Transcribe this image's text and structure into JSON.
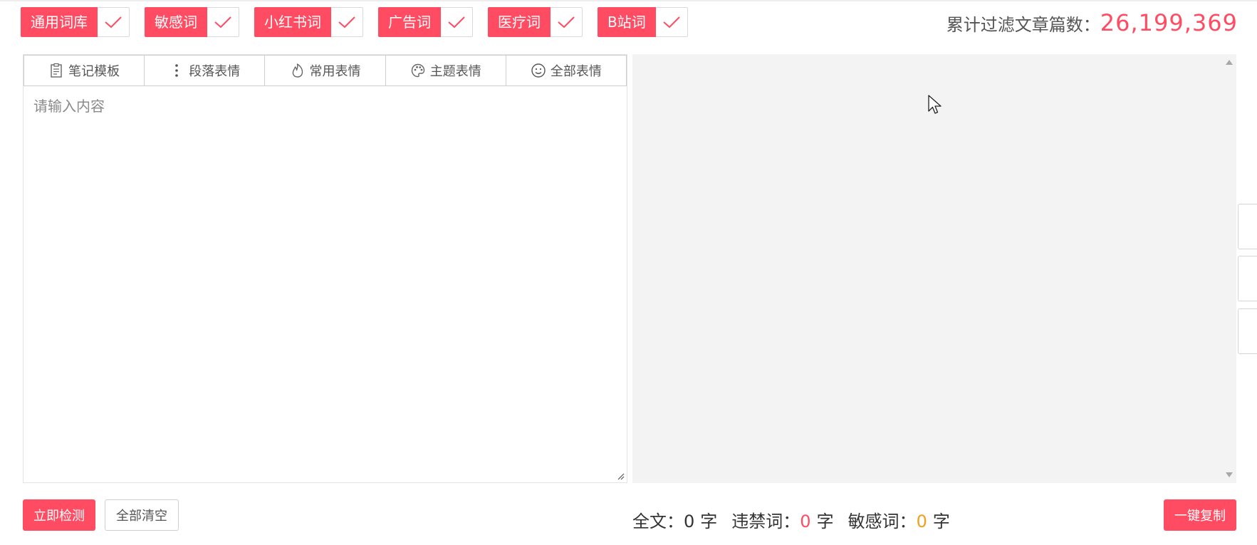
{
  "colors": {
    "accent": "#ff4c63",
    "sensitive": "#f0a020",
    "preview_bg": "#f3f3f3"
  },
  "tags": [
    {
      "label": "通用词库",
      "checked": true
    },
    {
      "label": "敏感词",
      "checked": true
    },
    {
      "label": "小红书词",
      "checked": true
    },
    {
      "label": "广告词",
      "checked": true
    },
    {
      "label": "医疗词",
      "checked": true
    },
    {
      "label": "B站词",
      "checked": true
    }
  ],
  "counter": {
    "label": "累计过滤文章篇数：",
    "value": "26,199,369"
  },
  "toolbar": [
    {
      "label": "笔记模板",
      "icon": "clipboard-icon"
    },
    {
      "label": "段落表情",
      "icon": "vertical-dots-icon"
    },
    {
      "label": "常用表情",
      "icon": "flame-icon"
    },
    {
      "label": "主题表情",
      "icon": "palette-icon"
    },
    {
      "label": "全部表情",
      "icon": "smiley-icon"
    }
  ],
  "editor": {
    "placeholder": "请输入内容",
    "value": ""
  },
  "actions": {
    "check_label": "立即检测",
    "clear_label": "全部清空",
    "copy_label": "一键复制"
  },
  "stats": {
    "total_label": "全文：",
    "total_value": "0",
    "banned_label": "违禁词：",
    "banned_value": "0",
    "sensitive_label": "敏感词：",
    "sensitive_value": "0",
    "unit": "字"
  }
}
